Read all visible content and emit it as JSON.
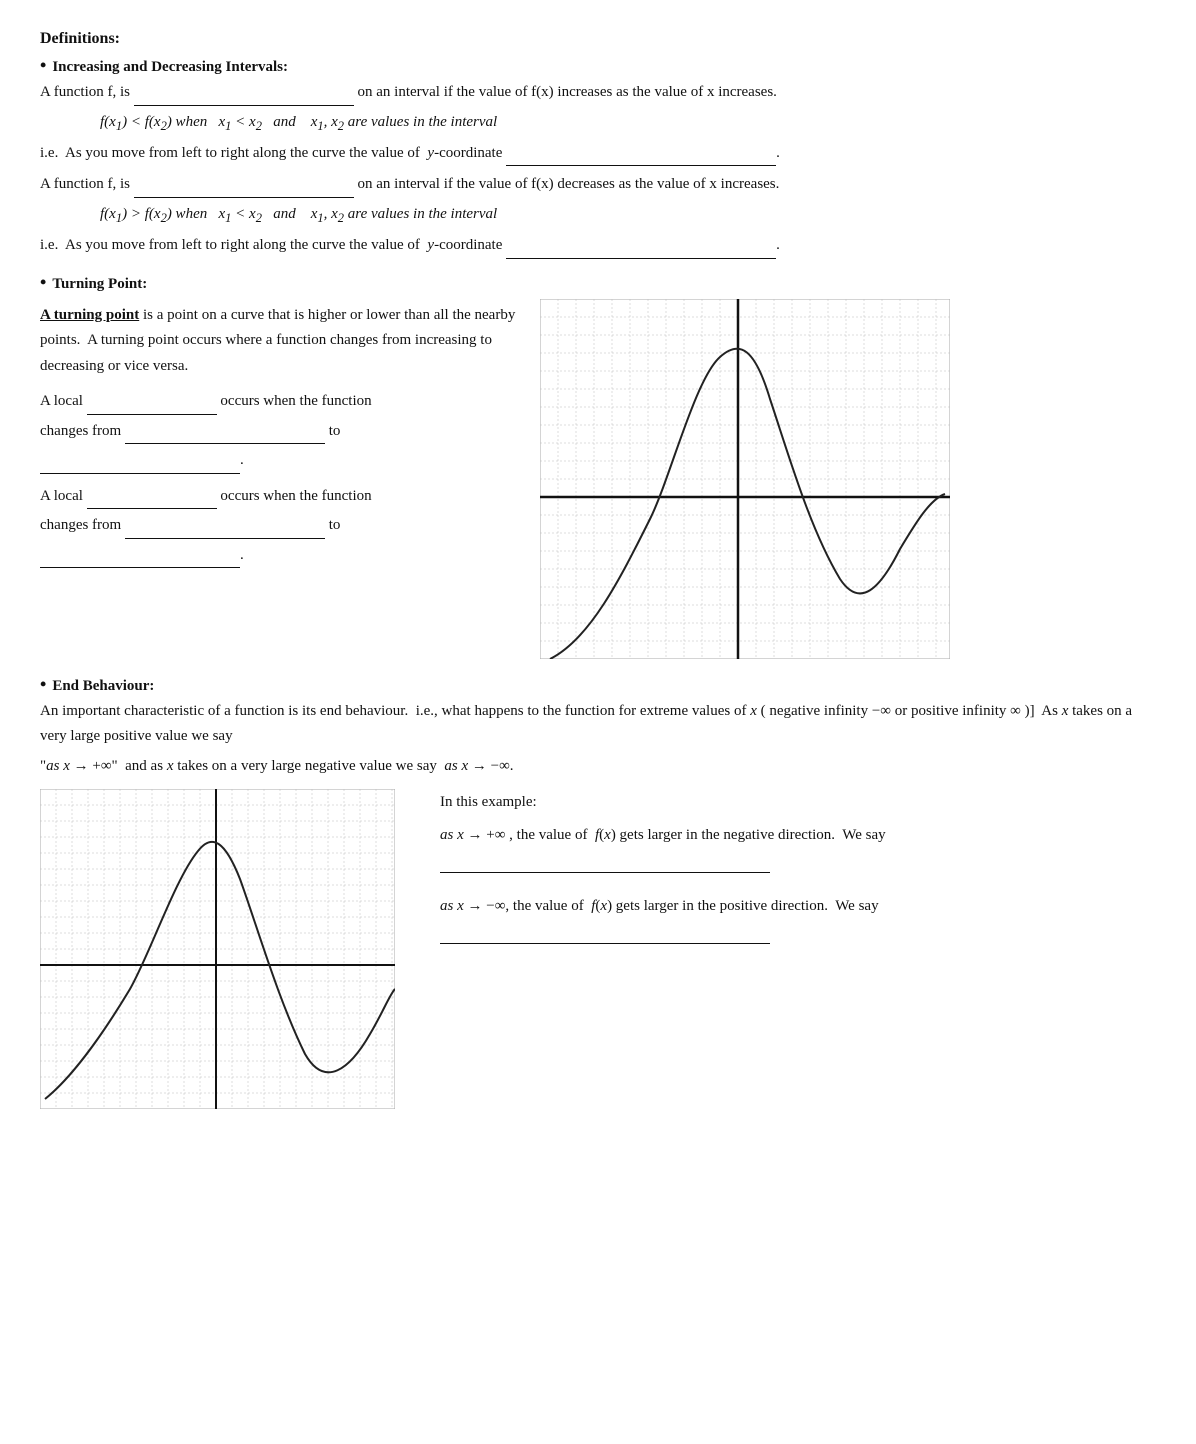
{
  "title": "Definitions:",
  "increasing_header": "Increasing and Decreasing Intervals:",
  "inc_text1": "A function f, is",
  "inc_text2": "on an interval if the value of f(x) increases as the value of x increases.",
  "inc_formula": "f(x₁) < f(x₂) when  x₁ < x₂ and   x₁, x₂ are values in the interval",
  "inc_ie": "i.e.  As you move from left to right along the curve the value of  y-coordinate",
  "dec_text1": "A function f, is",
  "dec_text2": "on an interval if the value of f(x) decreases as the value of x increases.",
  "dec_formula": "f(x₁) > f(x₂) when  x₁ < x₂ and   x₁, x₂ are values in the interval",
  "dec_ie": "i.e.  As you move from left to right along the curve the value of  y-coordinate",
  "turning_header": "Turning Point:",
  "turning_def": "A turning point is a point on a curve that is higher or lower than all the nearby points.  A turning point occurs where a function changes from increasing to decreasing or vice versa.",
  "local1_text1": "A local",
  "local1_text2": "occurs when the function",
  "local1_changes": "changes from",
  "local1_to": "to",
  "local2_text1": "A local",
  "local2_text2": "occurs when the function",
  "local2_changes": "changes from",
  "local2_to": "to",
  "end_header": "End Behaviour:",
  "end_para": "An important characteristic of a function is its end behaviour.  i.e., what happens to the function for extreme values of x ( negative infinity −∞ or positive infinity ∞ )]  As x takes on a very large positive value we say",
  "end_quote": "\"as x → +∞\"  and as x takes on a very large negative value we say  as x → −∞.",
  "in_this_example": "In this example:",
  "end_as_pos": "as x → +∞ , the value of  f(x) gets larger in the negative direction.  We say",
  "end_as_neg": "as x → −∞, the value of  f(x) gets larger in the positive direction.  We say"
}
